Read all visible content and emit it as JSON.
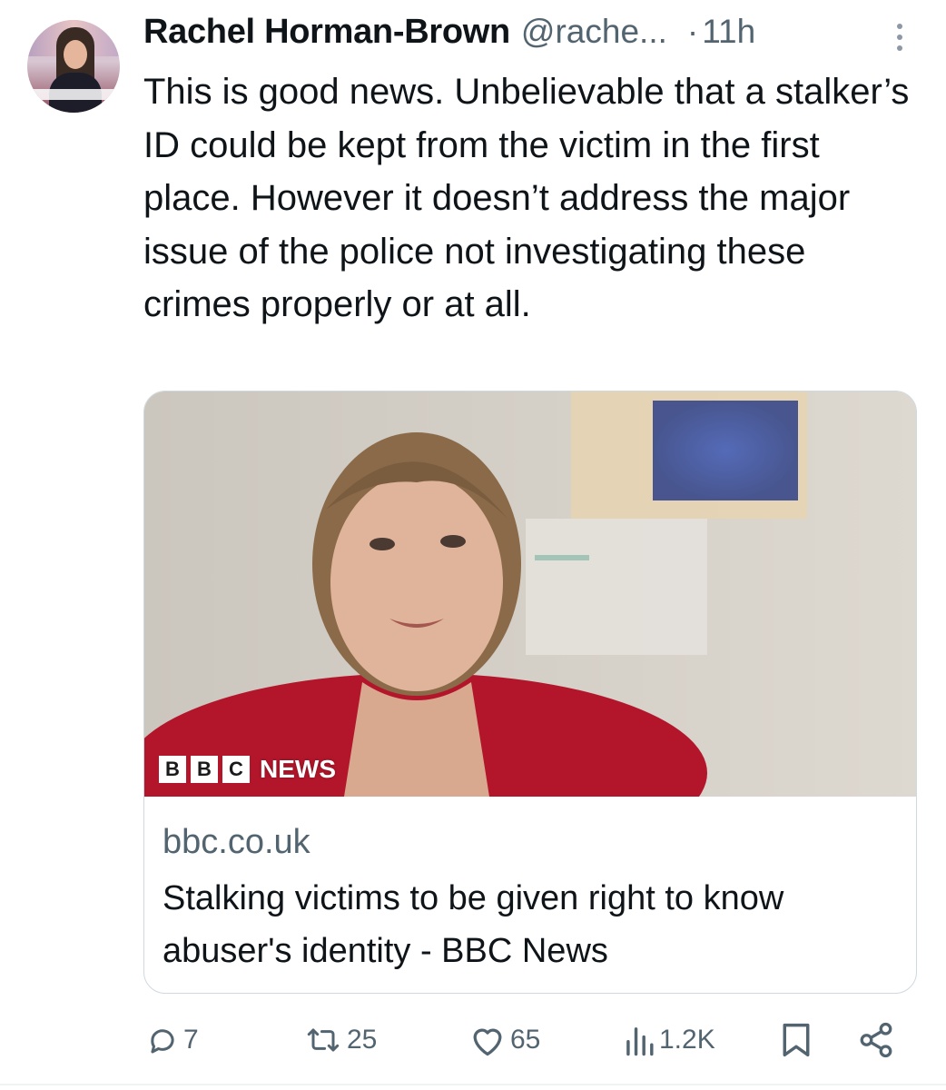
{
  "author": {
    "name": "Rachel Horman-Brown",
    "handle": "@rache...",
    "separator": "·",
    "time": "11h"
  },
  "tweet": {
    "text": "This is good news. Unbelievable that a stalker’s ID could be kept from the victim in the first place. However it doesn’t address the major issue of the police not investigating these crimes properly or at all."
  },
  "card": {
    "logo_letters": [
      "B",
      "B",
      "C"
    ],
    "logo_news": "NEWS",
    "domain": "bbc.co.uk",
    "title": "Stalking victims to be given right to know abuser's identity - BBC News"
  },
  "actions": {
    "replies": "7",
    "retweets": "25",
    "likes": "65",
    "views": "1.2K"
  },
  "icons": {
    "reply": "reply-icon",
    "retweet": "retweet-icon",
    "like": "heart-icon",
    "views": "views-icon",
    "bookmark": "bookmark-icon",
    "share": "share-icon",
    "more": "more-vertical-icon"
  },
  "colors": {
    "text_primary": "#0f1419",
    "text_secondary": "#536471",
    "border": "#cfd9de",
    "bbc_red_jacket": "#b3162b"
  }
}
